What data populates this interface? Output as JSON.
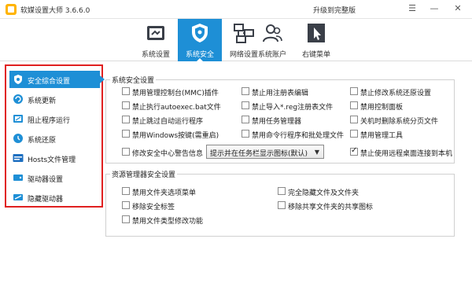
{
  "titlebar": {
    "title": "软媒设置大师 3.6.6.0",
    "upgrade": "升级到完整版"
  },
  "toolbar": {
    "tabs": [
      {
        "label": "系统设置",
        "icon": "toolbox-icon"
      },
      {
        "label": "系统安全",
        "icon": "shield-icon"
      },
      {
        "label": "网络设置",
        "icon": "network-icon"
      },
      {
        "label": "系统账户",
        "icon": "users-icon"
      },
      {
        "label": "右键菜单",
        "icon": "cursor-icon"
      }
    ],
    "active_tab": "系统安全"
  },
  "sidebar": {
    "items": [
      {
        "label": "安全综合设置",
        "icon": "shield-icon",
        "color": "#1e8fd6"
      },
      {
        "label": "系统更新",
        "icon": "update-icon",
        "color": "#1e8fd6"
      },
      {
        "label": "阻止程序运行",
        "icon": "block-icon",
        "color": "#1e8fd6"
      },
      {
        "label": "系统还原",
        "icon": "restore-icon",
        "color": "#1e8fd6"
      },
      {
        "label": "Hosts文件管理",
        "icon": "hosts-icon",
        "color": "#1e6fc0"
      },
      {
        "label": "驱动器设置",
        "icon": "drive-icon",
        "color": "#1e8fd6"
      },
      {
        "label": "隐藏驱动器",
        "icon": "hidden-drive-icon",
        "color": "#1e8fd6"
      }
    ],
    "active_item": "安全综合设置"
  },
  "system_security": {
    "title": "系统安全设置",
    "options": [
      {
        "label": "禁用管理控制台(MMC)插件",
        "checked": false
      },
      {
        "label": "禁止用注册表编辑",
        "checked": false
      },
      {
        "label": "禁止修改系统还原设置",
        "checked": false
      },
      {
        "label": "禁止执行autoexec.bat文件",
        "checked": false
      },
      {
        "label": "禁止导入*.reg注册表文件",
        "checked": false
      },
      {
        "label": "禁用控制面板",
        "checked": false
      },
      {
        "label": "禁止跳过自动运行程序",
        "checked": false
      },
      {
        "label": "禁用任务管理器",
        "checked": false
      },
      {
        "label": "关机时删除系统分页文件",
        "checked": false
      },
      {
        "label": "禁用Windows按键(需重启)",
        "checked": false
      },
      {
        "label": "禁用命令行程序和批处理文件",
        "checked": false
      },
      {
        "label": "禁用管理工具",
        "checked": false
      }
    ],
    "security_center": {
      "label": "修改安全中心警告信息",
      "checked": false
    },
    "dropdown_value": "提示并在任务栏显示图标(默认)",
    "remote_desktop": {
      "label": "禁止使用远程桌面连接到本机",
      "checked": true
    }
  },
  "explorer_security": {
    "title": "资源管理器安全设置",
    "options": [
      {
        "label": "禁用文件夹选项菜单",
        "checked": false
      },
      {
        "label": "完全隐藏文件及文件夹",
        "checked": false
      },
      {
        "label": "移除安全标签",
        "checked": false
      },
      {
        "label": "移除共享文件夹的共享图标",
        "checked": false
      },
      {
        "label": "禁用文件类型修改功能",
        "checked": false
      }
    ]
  }
}
